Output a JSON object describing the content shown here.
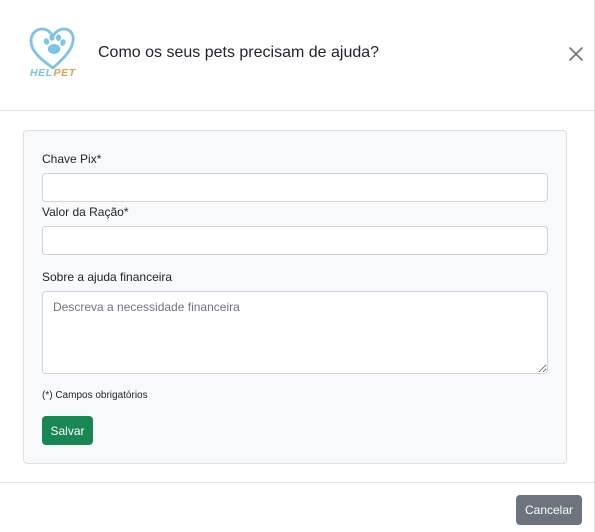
{
  "header": {
    "logo_text": "HELPET",
    "title": "Como os seus pets precisam de ajuda?",
    "close_icon": "close-icon"
  },
  "form": {
    "pix_label": "Chave Pix*",
    "pix_value": "",
    "ration_label": "Valor da Ração*",
    "ration_value": "",
    "about_label": "Sobre a ajuda financeira",
    "about_placeholder": "Descreva a necessidade financeira",
    "required_note": "(*) Campos obrigatórios",
    "save_label": "Salvar"
  },
  "footer": {
    "cancel_label": "Cancelar"
  },
  "colors": {
    "logo_blue": "#7cc4e6",
    "logo_orange": "#e8a050",
    "save_button": "#198754",
    "cancel_button": "#6c757d"
  }
}
